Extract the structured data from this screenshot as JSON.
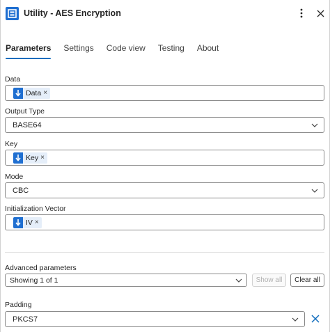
{
  "header": {
    "title": "Utility - AES Encryption",
    "logo_icon": "connector-logo-icon",
    "more_icon": "more-vertical-icon",
    "close_icon": "close-icon"
  },
  "tabs": [
    {
      "label": "Parameters",
      "active": true
    },
    {
      "label": "Settings",
      "active": false
    },
    {
      "label": "Code view",
      "active": false
    },
    {
      "label": "Testing",
      "active": false
    },
    {
      "label": "About",
      "active": false
    }
  ],
  "fields": {
    "data": {
      "label": "Data",
      "token": "Data"
    },
    "output_type": {
      "label": "Output Type",
      "value": "BASE64"
    },
    "key": {
      "label": "Key",
      "token": "Key"
    },
    "mode": {
      "label": "Mode",
      "value": "CBC"
    },
    "iv": {
      "label": "Initialization Vector",
      "token": "IV"
    }
  },
  "advanced": {
    "label": "Advanced parameters",
    "selected": "Showing 1 of 1",
    "show_all": "Show all",
    "clear_all": "Clear all"
  },
  "padding": {
    "label": "Padding",
    "value": "PKCS7"
  },
  "colors": {
    "accent": "#0f6cbd",
    "token_bg": "#e5eef9",
    "token_icon_bg": "#1f6fd1",
    "border": "#8a8a8a"
  }
}
